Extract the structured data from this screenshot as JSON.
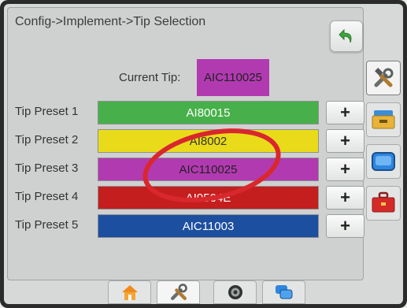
{
  "header": {
    "breadcrumb": "Config->Implement->Tip Selection"
  },
  "current_tip": {
    "label": "Current Tip:",
    "value": "AIC110025",
    "color": "#b23ab1"
  },
  "presets": [
    {
      "label": "Tip Preset 1",
      "value": "AI80015",
      "color": "#47b04a",
      "text_color": "#ffffff"
    },
    {
      "label": "Tip Preset 2",
      "value": "AI8002",
      "color": "#eadb1a",
      "text_color": "#333333"
    },
    {
      "label": "Tip Preset 3",
      "value": "AIC110025",
      "color": "#b23ab1",
      "text_color": "#222222"
    },
    {
      "label": "Tip Preset 4",
      "value": "AI9504E",
      "color": "#c41e1e",
      "text_color": "#ffffff"
    },
    {
      "label": "Tip Preset 5",
      "value": "AIC11003",
      "color": "#1d4fa0",
      "text_color": "#ffffff"
    }
  ],
  "plus_label": "+",
  "side_tabs": [
    {
      "icon": "tools-icon",
      "active": true
    },
    {
      "icon": "console-icon",
      "active": false
    },
    {
      "icon": "display-icon",
      "active": false
    },
    {
      "icon": "toolbox-icon",
      "active": false
    }
  ],
  "bottom_tabs": [
    {
      "icon": "home-icon",
      "active": false
    },
    {
      "icon": "tools-icon",
      "active": true
    },
    {
      "icon": "camera-icon",
      "active": false
    },
    {
      "icon": "screens-icon",
      "active": false
    }
  ],
  "annotation_color": "#d9272e"
}
